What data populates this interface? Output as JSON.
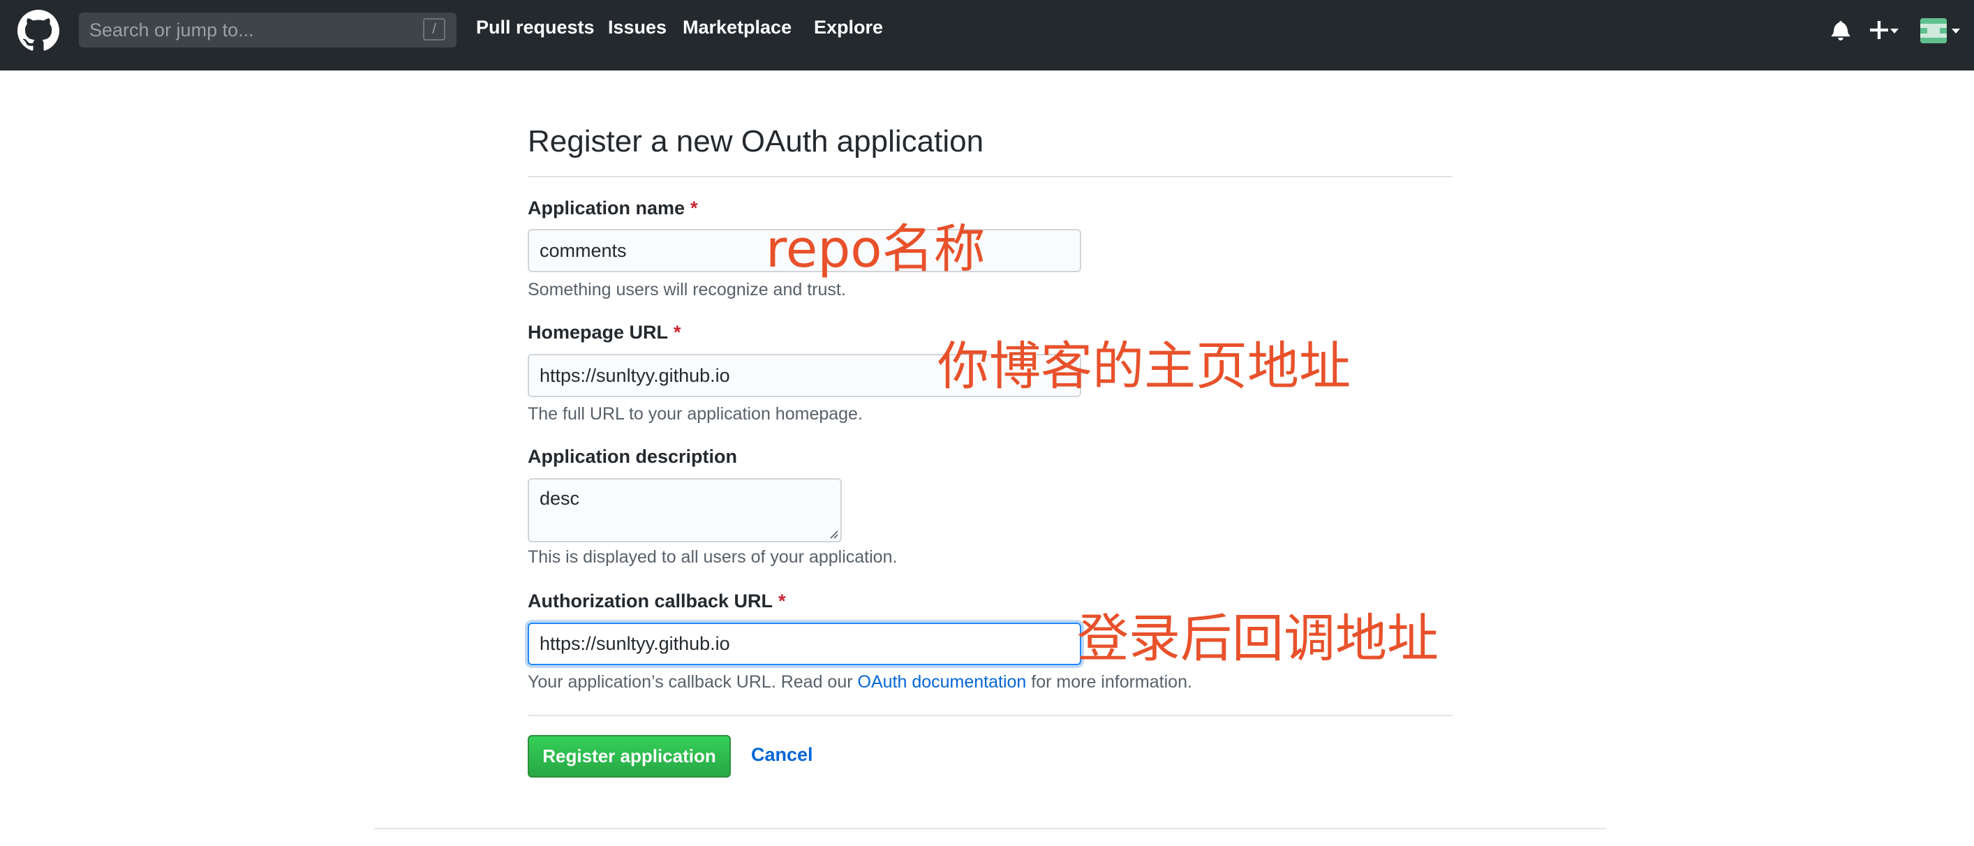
{
  "header": {
    "search_placeholder": "Search or jump to...",
    "search_shortcut": "/",
    "nav": [
      "Pull requests",
      "Issues",
      "Marketplace",
      "Explore"
    ],
    "icons": [
      "github-logo",
      "bell-icon",
      "plus-icon",
      "avatar"
    ]
  },
  "form": {
    "title": "Register a new OAuth application",
    "required_marker": "*",
    "app_name": {
      "label": "Application name",
      "value": "comments",
      "note": "Something users will recognize and trust."
    },
    "homepage": {
      "label": "Homepage URL",
      "value": "https://sunltyy.github.io",
      "note": "The full URL to your application homepage."
    },
    "description": {
      "label": "Application description",
      "value": "desc",
      "note": "This is displayed to all users of your application."
    },
    "callback": {
      "label": "Authorization callback URL",
      "value": "https://sunltyy.github.io",
      "note_before": "Your application’s callback URL. Read our ",
      "note_link": "OAuth documentation",
      "note_after": " for more information."
    },
    "register_button": "Register application",
    "cancel_link": "Cancel"
  },
  "annotations": {
    "app_name": "repo名称",
    "homepage": "你博客的主页地址",
    "callback": "登录后回调地址"
  },
  "colors": {
    "header_bg": "#24292e",
    "link": "#0366d6",
    "required": "#cb2431",
    "primary_button": "#28a745",
    "annotation": "#e8512b"
  }
}
